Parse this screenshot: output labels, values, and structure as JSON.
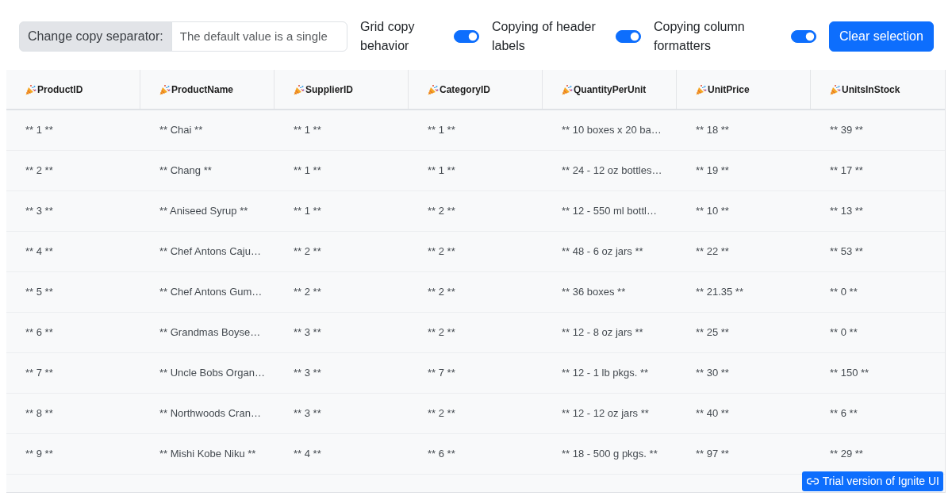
{
  "toolbar": {
    "separator": {
      "label": "Change copy separator:",
      "placeholder": "The default value is a single"
    },
    "toggles": [
      {
        "label": "Grid copy behavior",
        "on": true
      },
      {
        "label": "Copying of header labels",
        "on": true
      },
      {
        "label": "Copying column formatters",
        "on": true
      }
    ],
    "clear_button": "Clear selection"
  },
  "grid": {
    "columns": [
      "ProductID",
      "ProductName",
      "SupplierID",
      "CategoryID",
      "QuantityPerUnit",
      "UnitPrice",
      "UnitsInStock"
    ],
    "rows": [
      [
        "** 1 **",
        "** Chai **",
        "** 1 **",
        "** 1 **",
        "** 10 boxes x 20 ba…",
        "** 18 **",
        "** 39 **"
      ],
      [
        "** 2 **",
        "** Chang **",
        "** 1 **",
        "** 1 **",
        "** 24 - 12 oz bottles…",
        "** 19 **",
        "** 17 **"
      ],
      [
        "** 3 **",
        "** Aniseed Syrup **",
        "** 1 **",
        "** 2 **",
        "** 12 - 550 ml bottl…",
        "** 10 **",
        "** 13 **"
      ],
      [
        "** 4 **",
        "** Chef Antons Caju…",
        "** 2 **",
        "** 2 **",
        "** 48 - 6 oz jars **",
        "** 22 **",
        "** 53 **"
      ],
      [
        "** 5 **",
        "** Chef Antons Gum…",
        "** 2 **",
        "** 2 **",
        "** 36 boxes **",
        "** 21.35 **",
        "** 0 **"
      ],
      [
        "** 6 **",
        "** Grandmas Boyse…",
        "** 3 **",
        "** 2 **",
        "** 12 - 8 oz jars **",
        "** 25 **",
        "** 0 **"
      ],
      [
        "** 7 **",
        "** Uncle Bobs Organ…",
        "** 3 **",
        "** 7 **",
        "** 12 - 1 lb pkgs. **",
        "** 30 **",
        "** 150 **"
      ],
      [
        "** 8 **",
        "** Northwoods Cran…",
        "** 3 **",
        "** 2 **",
        "** 12 - 12 oz jars **",
        "** 40 **",
        "** 6 **"
      ],
      [
        "** 9 **",
        "** Mishi Kobe Niku **",
        "** 4 **",
        "** 6 **",
        "** 18 - 500 g pkgs. **",
        "** 97 **",
        "** 29 **"
      ]
    ]
  },
  "trial_link": "Trial version of Ignite UI"
}
